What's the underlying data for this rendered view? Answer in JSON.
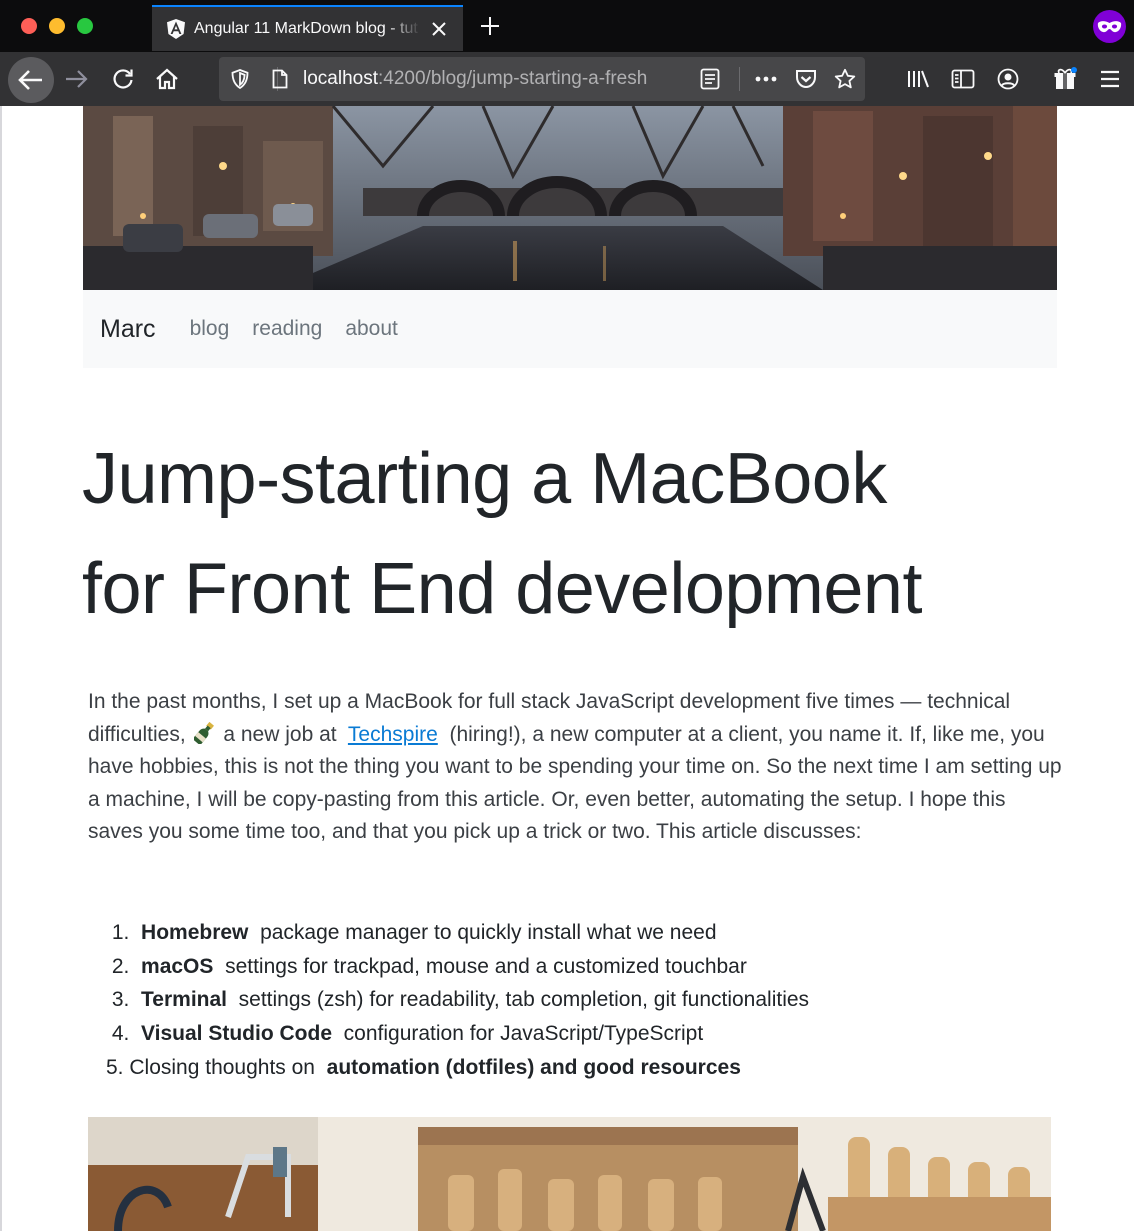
{
  "browser": {
    "tab_title": "Angular 11 MarkDown blog - tut",
    "url_host": "localhost",
    "url_path": ":4200/blog/jump-starting-a-fresh",
    "colors": {
      "accent": "#0a84ff",
      "private": "#8000d7",
      "toolbar": "#323234",
      "tabstrip": "#0c0c0d"
    }
  },
  "site": {
    "brand": "Marc",
    "nav": [
      {
        "label": "blog"
      },
      {
        "label": "reading"
      },
      {
        "label": "about"
      }
    ]
  },
  "post": {
    "title_line1": "Jump-starting a MacBook",
    "title_line2": "for Front End development",
    "intro": {
      "part1": "In the past months, I set up a MacBook for full stack JavaScript development five times — technical difficulties,",
      "part2": "a new job at",
      "link": "Techspire",
      "part3": "(hiring!), a new computer at a client, you name it. If, like me, you have hobbies, this is not the thing you want to be spending your time on. So the next time I am setting up a machine, I will be copy-pasting from this article. Or, even better, automating the setup. I hope this saves you some time too, and that you pick up a trick or two. This article discusses:"
    },
    "toc": [
      {
        "num": "1.",
        "bold": "Homebrew",
        "rest": "package manager to quickly install what we need"
      },
      {
        "num": "2.",
        "bold": "macOS",
        "rest": "settings for trackpad, mouse and a customized touchbar"
      },
      {
        "num": "3.",
        "bold": "Terminal",
        "rest": "settings (zsh) for readability, tab completion, git functionalities"
      },
      {
        "num": "4.",
        "bold": "Visual Studio Code",
        "rest": "configuration for JavaScript/TypeScript"
      },
      {
        "num": "5.",
        "pre": "Closing thoughts on",
        "bold": "automation (dotfiles) and good resources"
      }
    ]
  }
}
